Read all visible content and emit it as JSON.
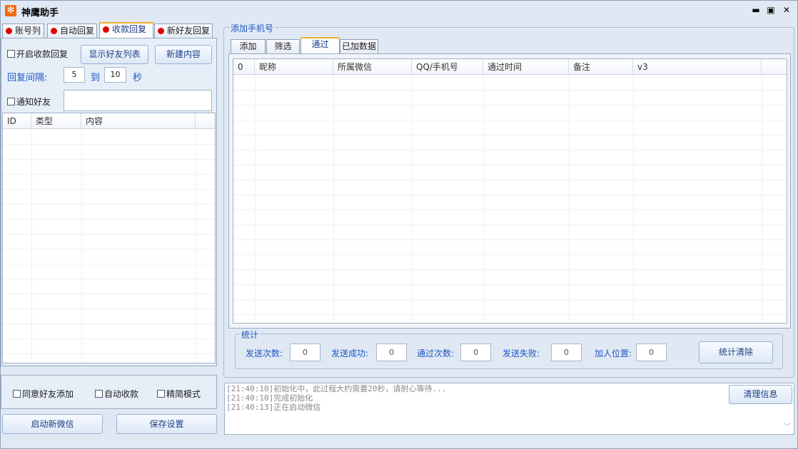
{
  "window": {
    "title": "神鹰助手",
    "app_icon": "✻",
    "minimize": "▬",
    "maximize": "▣",
    "close": "✕"
  },
  "left_tabs": [
    {
      "label": "账号列",
      "active": false
    },
    {
      "label": "自动回复",
      "active": false
    },
    {
      "label": "收款回复",
      "active": true
    },
    {
      "label": "新好友回复",
      "active": false
    }
  ],
  "payment_reply": {
    "enable_checkbox": "开启收款回复",
    "show_friends_button": "显示好友列表",
    "new_content_button": "新建内容",
    "interval_label": "回复间隔:",
    "interval_from": "5",
    "interval_to_label": "到",
    "interval_to": "10",
    "seconds_label": "秒",
    "notify_checkbox": "通知好友",
    "notify_value": "",
    "table_columns": [
      "ID",
      "类型",
      "内容"
    ]
  },
  "left_bottom": {
    "agree_friend": "同意好友添加",
    "auto_collect": "自动收款",
    "simple_mode": "精简模式",
    "launch_button": "启动新微信",
    "save_button": "保存设置"
  },
  "right": {
    "group_title": "添加手机号",
    "tabs": [
      {
        "label": "添加",
        "active": false
      },
      {
        "label": "筛选",
        "active": false
      },
      {
        "label": "通过",
        "active": true
      },
      {
        "label": "已加数据",
        "active": false
      }
    ],
    "table_columns": [
      "0",
      "昵称",
      "所属微信",
      "QQ/手机号",
      "通过时间",
      "备注",
      "v3"
    ]
  },
  "stats": {
    "title": "统计",
    "send_count_label": "发送次数:",
    "send_count": "0",
    "send_success_label": "发送成功:",
    "send_success": "0",
    "pass_count_label": "通过次数:",
    "pass_count": "0",
    "send_fail_label": "发送失败:",
    "send_fail": "0",
    "join_pos_label": "加人位置:",
    "join_pos": "0",
    "clear_button": "统计清除"
  },
  "log": {
    "lines": [
      "[21:40:10]初始化中，此过程大约需要20秒，请耐心等待...",
      "[21:40:10]完成初始化",
      "[21:40:13]正在启动微信"
    ],
    "clear_button": "清理信息"
  }
}
